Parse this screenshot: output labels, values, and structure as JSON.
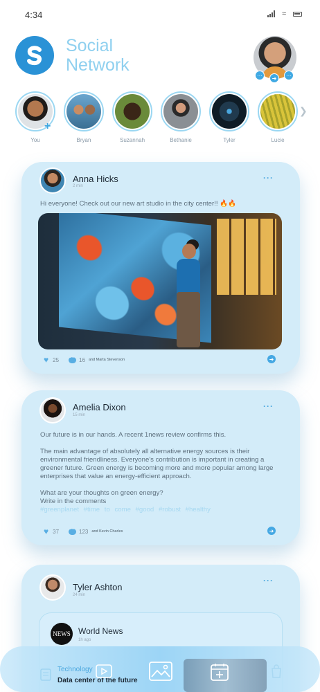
{
  "status": {
    "time": "4:34"
  },
  "app": {
    "title_line1": "Social",
    "title_line2": "Network"
  },
  "stories": [
    {
      "name": "You"
    },
    {
      "name": "Bryan"
    },
    {
      "name": "Suzannah"
    },
    {
      "name": "Bethanie"
    },
    {
      "name": "Tyler"
    },
    {
      "name": "Lucie"
    }
  ],
  "posts": [
    {
      "author": "Anna Hicks",
      "ago": "2 min",
      "text": "Hi everyone! Check out our new art studio in the city center!! 🔥🔥",
      "likes": "25",
      "comments": "16",
      "commenter": "and Marta Stevenson"
    },
    {
      "author": "Amelia Dixon",
      "ago": "15 min",
      "p1": "Our future is in our hands. A recent 1news review confirms this.",
      "p2": "The main advantage of absolutely all alternative energy sources is their environmental friendliness. Everyone's contribution is important in creating a greener future. Green energy is becoming more and more popular among large enterprises that value an energy-efficient approach.",
      "p3a": "What are your thoughts on green energy?",
      "p3b": "Write in the comments",
      "tags": "#greenplanet #time to come #good #robust #healthy",
      "likes": "37",
      "comments": "123",
      "commenter": "and Kevin Charles"
    },
    {
      "author": "Tyler Ashton",
      "ago": "24 min",
      "shared_source": "World News",
      "shared_ago": "1h ago",
      "shared_logo": "NEWS"
    }
  ],
  "bottom": {
    "category": "Technology",
    "headline": "Data center of the future"
  },
  "colors": {
    "accent": "#2a92d6",
    "card": "#d3ecf9"
  }
}
